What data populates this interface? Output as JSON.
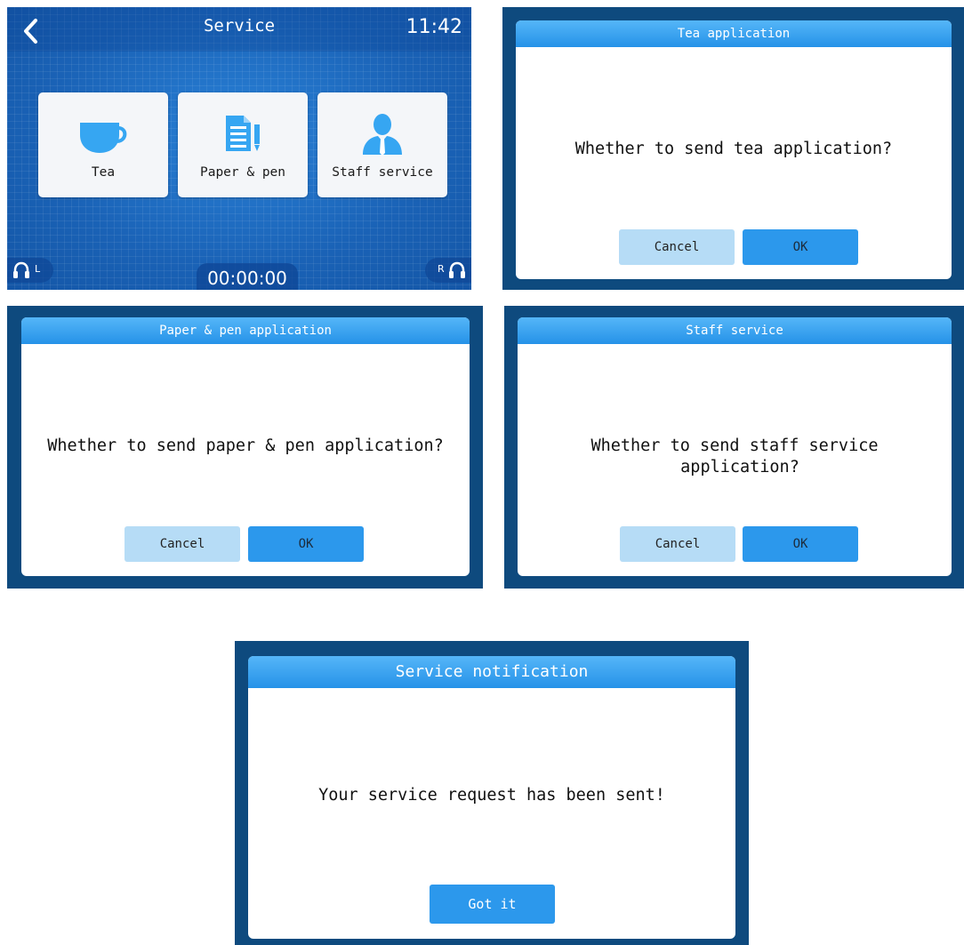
{
  "service_screen": {
    "title": "Service",
    "time": "11:42",
    "timer": "00:00:00",
    "left_label": "L",
    "right_label": "R",
    "tiles": [
      {
        "label": "Tea",
        "icon": "tea-cup-icon"
      },
      {
        "label": "Paper & pen",
        "icon": "document-pen-icon"
      },
      {
        "label": "Staff service",
        "icon": "staff-person-icon"
      }
    ],
    "colors": {
      "background": "#1a66bc",
      "tile": "#f4f6f9",
      "icon_blue": "#36a6f2"
    }
  },
  "dialogs": {
    "tea": {
      "title": "Tea application",
      "message": "Whether to send tea application?",
      "cancel": "Cancel",
      "ok": "OK"
    },
    "paper": {
      "title": "Paper & pen application",
      "message": "Whether to send paper &  pen application?",
      "cancel": "Cancel",
      "ok": "OK"
    },
    "staff": {
      "title": "Staff service",
      "message_line1": "Whether to send staff service",
      "message_line2": "application?",
      "cancel": "Cancel",
      "ok": "OK"
    },
    "notification": {
      "title": "Service notification",
      "message": "Your service request has been sent!",
      "button": "Got it"
    }
  },
  "colors": {
    "frame": "#0e4a7e",
    "title_bar": "#2592e8",
    "cancel_button": "#b6dcf6",
    "ok_button": "#2c98ec"
  }
}
